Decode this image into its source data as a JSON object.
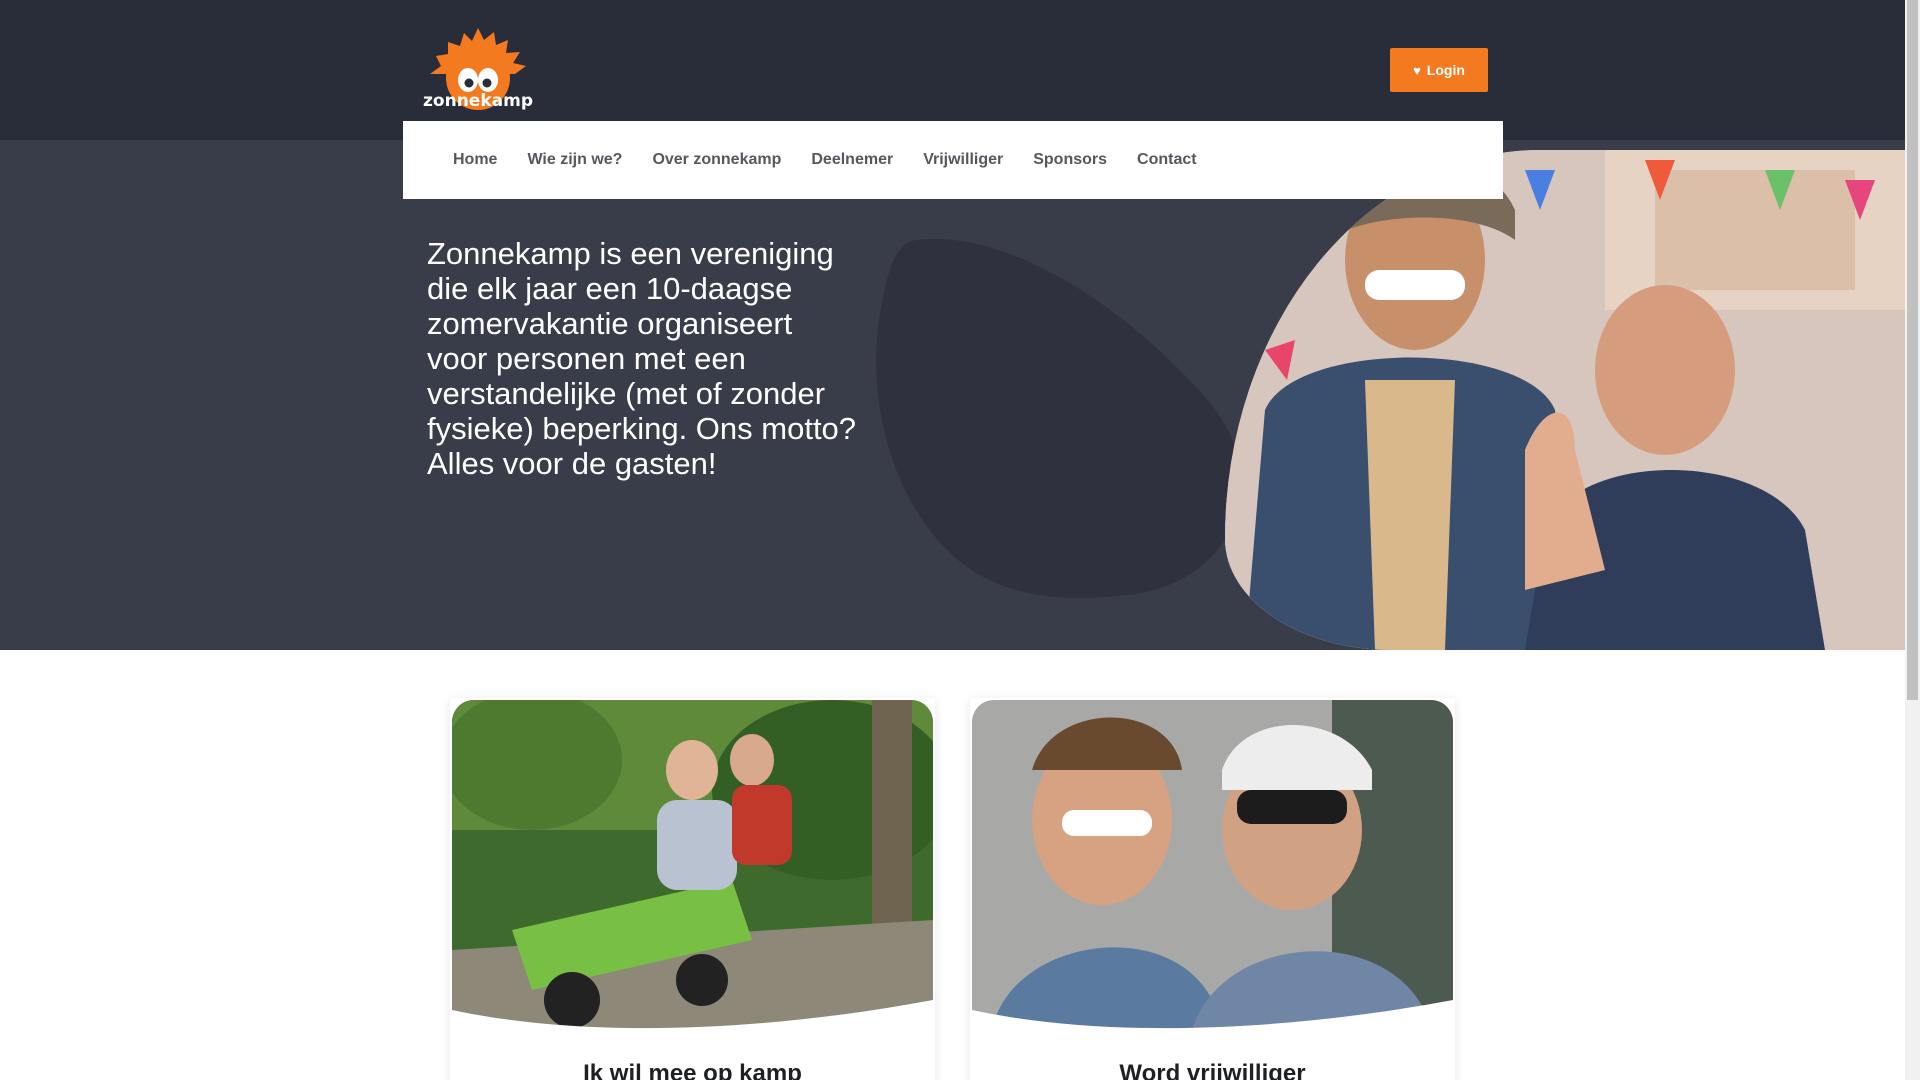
{
  "header": {
    "logo_text": "zonnekamp",
    "login_label": "Login"
  },
  "nav": {
    "items": [
      "Home",
      "Wie zijn we?",
      "Over zonnekamp",
      "Deelnemer",
      "Vrijwilliger",
      "Sponsors",
      "Contact"
    ]
  },
  "hero": {
    "text": "Zonnekamp is een vereniging die elk jaar een 10-daagse zomervakantie organiseert voor personen met een verstandelijke (met of zonder fysieke) beperking. Ons motto? Alles voor de gasten!"
  },
  "cards": [
    {
      "title": "Ik wil mee op kamp"
    },
    {
      "title": "Word vrijwilliger"
    }
  ],
  "colors": {
    "header_bg": "#292d3a",
    "hero_bg": "#393c49",
    "accent": "#f47a20"
  }
}
